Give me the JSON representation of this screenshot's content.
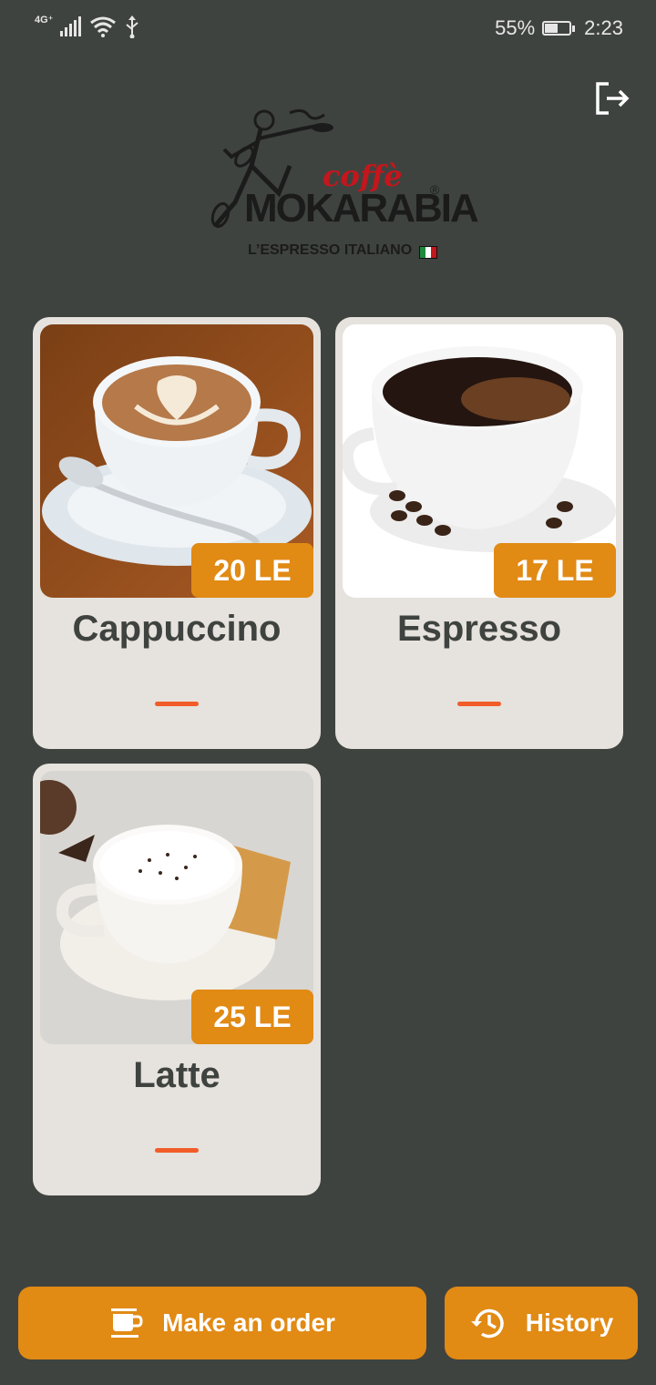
{
  "status_bar": {
    "network": "4G⁺",
    "battery_percent": "55%",
    "battery_level": 0.55,
    "time": "2:23"
  },
  "header": {
    "logout_icon": "logout-icon",
    "logo": {
      "coffe": "coffè",
      "brand": "MOKARABIA",
      "registered": "®",
      "tagline": "L’ESPRESSO ITALIANO"
    }
  },
  "products": [
    {
      "name": "Cappuccino",
      "price": "20 LE"
    },
    {
      "name": "Espresso",
      "price": "17 LE"
    },
    {
      "name": "Latte",
      "price": "25 LE"
    }
  ],
  "actions": {
    "order_label": "Make an order",
    "order_icon": "coffee-cup-icon",
    "history_label": "History",
    "history_icon": "history-icon"
  },
  "colors": {
    "background": "#3f4340",
    "card": "#e6e2dd",
    "accent": "#e18a14",
    "dash": "#f25c28",
    "text_dark": "#3f4340"
  }
}
